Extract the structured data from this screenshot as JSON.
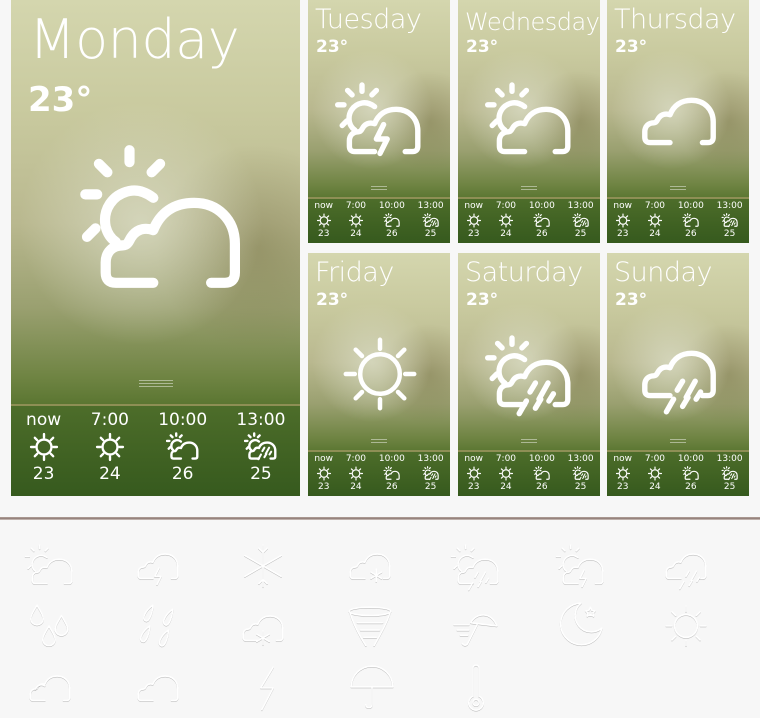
{
  "cards": {
    "monday": {
      "day": "Monday",
      "temp": "23°",
      "condition": "partly-cloudy-icon"
    },
    "tuesday": {
      "day": "Tuesday",
      "temp": "23°",
      "condition": "partly-cloudy-thunder-icon"
    },
    "wednesday": {
      "day": "Wednesday",
      "temp": "23°",
      "condition": "partly-cloudy-icon"
    },
    "thursday": {
      "day": "Thursday",
      "temp": "23°",
      "condition": "cloud-icon"
    },
    "friday": {
      "day": "Friday",
      "temp": "23°",
      "condition": "sun-icon"
    },
    "saturday": {
      "day": "Saturday",
      "temp": "23°",
      "condition": "partly-cloudy-rain-icon"
    },
    "sunday": {
      "day": "Sunday",
      "temp": "23°",
      "condition": "cloud-rain-icon"
    }
  },
  "forecast": [
    {
      "time": "now",
      "icon": "sun-icon",
      "temp": "23"
    },
    {
      "time": "7:00",
      "icon": "sun-icon",
      "temp": "24"
    },
    {
      "time": "10:00",
      "icon": "partly-cloudy-icon",
      "temp": "26"
    },
    {
      "time": "13:00",
      "icon": "partly-cloudy-storm-icon",
      "temp": "25"
    }
  ],
  "icon_set": [
    "partly-cloudy-icon",
    "cloud-thunder-icon",
    "snowflake-icon",
    "cloud-snow-icon",
    "partly-cloudy-rain-icon",
    "partly-cloudy-thunder-icon",
    "cloud-rain-icon",
    "raindrops-icon",
    "rain-streaks-icon",
    "cloud-heavy-snow-icon",
    "tornado-icon",
    "wind-umbrella-icon",
    "moon-stars-icon",
    "sun-icon",
    "cloudy-icon",
    "cloud-outline-icon",
    "lightning-icon",
    "umbrella-icon",
    "thermometer-icon"
  ],
  "colors": {
    "card_top": "#d4d6ae",
    "card_bottom": "#52702a",
    "forecast_bar": "#3f6122",
    "page_background": "#f7f7f7",
    "divider": "#8c7873"
  }
}
